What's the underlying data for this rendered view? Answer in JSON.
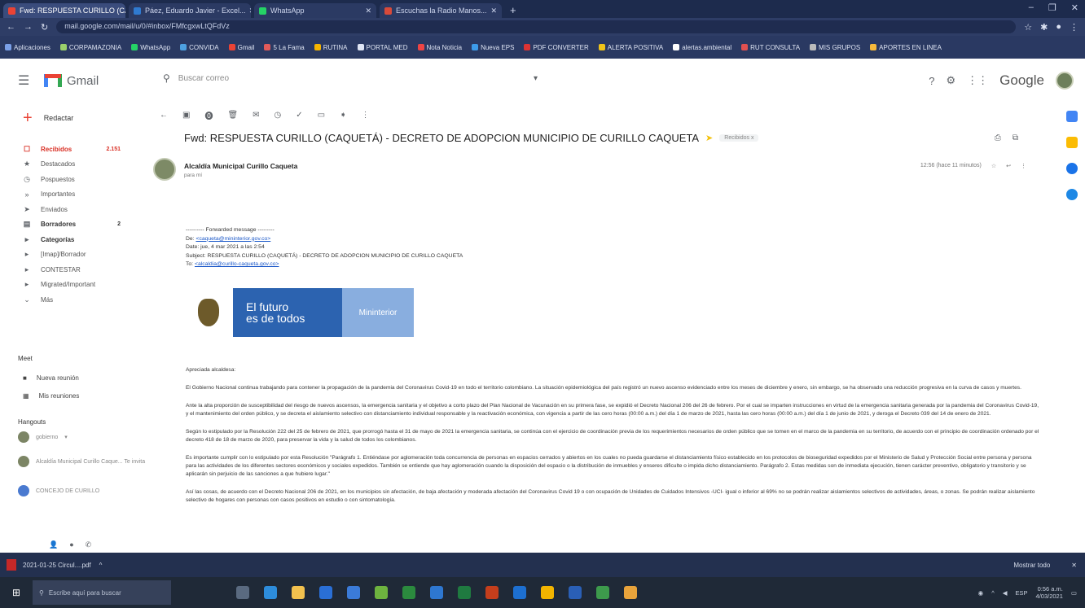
{
  "browser": {
    "tabs": [
      {
        "label": "Fwd: RESPUESTA CURILLO (CAQ...",
        "active": true
      },
      {
        "label": "Páez, Eduardo Javier - Excel...",
        "active": false
      },
      {
        "label": "WhatsApp",
        "active": false
      },
      {
        "label": "Escuchas la Radio Manos...",
        "active": false
      }
    ],
    "new_tab": "+",
    "window_controls": [
      "–",
      "❐",
      "✕"
    ],
    "url": "mail.google.com/mail/u/0/#inbox/FMfcgxwLtQFdVz",
    "bookmarks": [
      "Aplicaciones",
      "CORPAMAZONIA",
      "WhatsApp",
      "CONVIDA",
      "Gmail",
      "5 La Fama",
      "RUTINA",
      "PORTAL MED",
      "Nota Noticia",
      "Nueva EPS",
      "PDF CONVERTER",
      "ALERTA POSITIVA",
      "alertas.ambiental",
      "RUT CONSULTA",
      "MIS GRUPOS",
      "APORTES EN LINEA"
    ]
  },
  "gmail": {
    "app_name": "Gmail",
    "search_placeholder": "Buscar correo",
    "google_word": "Google",
    "compose_label": "Redactar",
    "nav": [
      {
        "icon": "inbox-icon",
        "glyph": "☐",
        "label": "Recibidos",
        "count": "2.151",
        "active": true
      },
      {
        "icon": "star-icon",
        "glyph": "★",
        "label": "Destacados",
        "count": ""
      },
      {
        "icon": "clock-icon",
        "glyph": "◷",
        "label": "Pospuestos",
        "count": ""
      },
      {
        "icon": "important-icon",
        "glyph": "»",
        "label": "Importantes",
        "count": ""
      },
      {
        "icon": "send-icon",
        "glyph": "➤",
        "label": "Enviados",
        "count": ""
      },
      {
        "icon": "draft-icon",
        "glyph": "▤",
        "label": "Borradores",
        "count": "2",
        "bold": true
      },
      {
        "icon": "label-icon",
        "glyph": "▸",
        "label": "Categorías",
        "count": "",
        "bold": true
      },
      {
        "icon": "label-icon",
        "glyph": "▸",
        "label": "[Imap]/Borrador",
        "count": ""
      },
      {
        "icon": "label-icon",
        "glyph": "▸",
        "label": "CONTESTAR",
        "count": ""
      },
      {
        "icon": "label-icon",
        "glyph": "▸",
        "label": "Migrated/Important",
        "count": ""
      },
      {
        "icon": "chevron-down-icon",
        "glyph": "⌄",
        "label": "Más",
        "count": ""
      }
    ],
    "meet": {
      "title": "Meet",
      "new_meeting": "Nueva reunión",
      "my_meetings": "Mis reuniones"
    },
    "hangouts": {
      "title": "Hangouts",
      "user": "gobierno",
      "contacts": [
        "Alcaldía Municipal Curillo Caque... Te invita",
        "CONCEJO DE CURILLO"
      ]
    }
  },
  "email": {
    "subject": "Fwd: RESPUESTA CURILLO (CAQUETÁ) - DECRETO DE ADOPCION MUNICIPIO DE CURILLO CAQUETA",
    "label_badge": "Recibidos x",
    "sender_name": "Alcaldía Municipal Curillo Caqueta",
    "sender_to": "para mí",
    "date": "12:56 (hace 11 minutos)",
    "forward_header": "---------- Forwarded message ---------",
    "from_label": "De:",
    "from_value": "<caqueta@mininterior.gov.co>",
    "date_label": "Date: jue, 4 mar 2021 a las 2:54",
    "subject_line": "Subject: RESPUESTA CURILLO (CAQUETÁ) - DECRETO DE ADOPCION MUNICIPIO DE CURILLO CAQUETA",
    "to_label": "To:",
    "to_value": "<alcaldia@curillo-caqueta.gov.co>",
    "banner_line1": "El futuro",
    "banner_line2": "es de todos",
    "banner_ministry": "Mininterior",
    "greeting": "Apreciada alcaldesa:",
    "paragraphs": [
      "El Gobierno Nacional continua trabajando para contener la propagación de la pandemia del Coronavirus Covid-19 en todo el territorio colombiano. La situación epidemiológica del país registró un nuevo ascenso evidenciado entre los meses de diciembre y enero, sin embargo, se ha observado una reducción progresiva en la curva de casos y muertes.",
      "Ante la alta proporción de susceptibilidad del riesgo de nuevos ascensos, la emergencia sanitaria y el objetivo a corto plazo del Plan Nacional de Vacunación en su primera fase, se expidió el Decreto Nacional 206 del 26 de febrero. Por el cual se imparten instrucciones en virtud de la emergencia sanitaria generada por la pandemia del Coronavirus Covid-19, y el mantenimiento del orden público, y se decreta el aislamiento selectivo con distanciamiento individual responsable y la reactivación económica, con vigencia a partir de las cero horas (00:00 a.m.) del día 1 de marzo de 2021, hasta las cero horas (00:00 a.m.) del día 1 de junio de 2021, y deroga el Decreto 039 del 14 de enero de 2021.",
      "Según lo estipulado por la Resolución 222 del 25 de febrero de 2021, que prorrogó hasta el 31 de mayo de 2021 la emergencia sanitaria, se continúa con el ejercicio de coordinación previa de los requerimientos necesarios de orden público que se tomen en el marco de la pandemia en su territorio, de acuerdo con el principio de coordinación ordenado por el decreto 418 de 18 de marzo de 2020, para preservar la vida y la salud de todos los colombianos.",
      "Es importante cumplir con lo estipulado por esta Resolución \"Parágrafo 1. Entiéndase por aglomeración toda concurrencia de personas en espacios cerrados y abiertos en los cuales no pueda guardarse el distanciamiento físico establecido en los protocolos de bioseguridad expedidos por el Ministerio de Salud y Protección Social entre persona y persona para las actividades de los diferentes sectores económicos y sociales expedidos. También se entiende que hay aglomeración cuando la disposición del espacio o la distribución de inmuebles y enseres dificulte o impida dicho distanciamiento. Parágrafo 2. Estas medidas son de inmediata ejecución, tienen carácter preventivo, obligatorio y transitorio y se aplicarán sin perjuicio de las sanciones a que hubiere lugar.\"",
      "Así las cosas, de acuerdo con el Decreto Nacional 206 de 2021, en los municipios sin afectación, de baja afectación y moderada afectación del Coronavirus Covid 19 o con ocupación de Unidades de Cuidados Intensivos -UCI- igual o inferior al 69% no se podrán realizar aislamientos selectivos de actividades, áreas, o zonas. Se podrán realizar aislamiento selectivo de hogares con personas con casos positivos en estudio o con sintomatología."
    ]
  },
  "downloads": {
    "file": "2021-01-25 Circul....pdf",
    "show_all": "Mostrar todo",
    "close": "✕"
  },
  "taskbar": {
    "search_placeholder": "Escribe aquí para buscar",
    "time": "0:56 a.m.",
    "date": "4/03/2021",
    "lang": "ESP"
  },
  "colors": {
    "gmail_red": "#d93025",
    "brand_blue": "#2c63b0",
    "taskbar": "#1f2937"
  }
}
